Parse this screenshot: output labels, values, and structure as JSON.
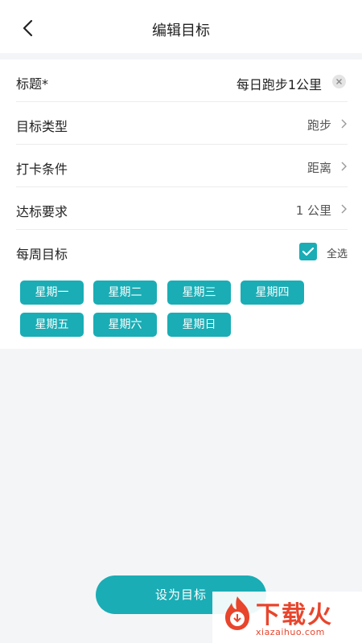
{
  "header": {
    "title": "编辑目标"
  },
  "form": {
    "title_row": {
      "label": "标题*",
      "value": "每日跑步1公里"
    },
    "type_row": {
      "label": "目标类型",
      "value": "跑步"
    },
    "condition_row": {
      "label": "打卡条件",
      "value": "距离"
    },
    "requirement_row": {
      "label": "达标要求",
      "value": "1 公里"
    },
    "weekly_row": {
      "label": "每周目标",
      "select_all_label": "全选",
      "select_all_checked": true
    }
  },
  "weekdays": [
    "星期一",
    "星期二",
    "星期三",
    "星期四",
    "星期五",
    "星期六",
    "星期日"
  ],
  "submit_label": "设为目标",
  "watermark": {
    "brand": "下载火",
    "url": "xiazaihuo.com"
  },
  "colors": {
    "accent": "#1aadb5",
    "watermark": "#e8452c"
  }
}
